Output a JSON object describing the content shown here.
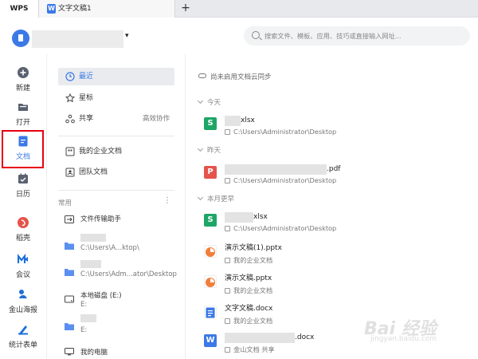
{
  "tabbar": {
    "app_tab": "WPS",
    "doc_tab": "文字文稿1",
    "add_tab": "+"
  },
  "header": {
    "caret": "▾",
    "search_placeholder": "搜索文件、模板、应用、技巧或直接输入网址..."
  },
  "rail": [
    {
      "name": "new",
      "label": "新建",
      "icon": "plus-circle-icon"
    },
    {
      "name": "open",
      "label": "打开",
      "icon": "folder-icon"
    },
    {
      "name": "docs",
      "label": "文档",
      "icon": "document-icon",
      "selected": true
    },
    {
      "name": "calendar",
      "label": "日历",
      "icon": "calendar-icon"
    },
    {
      "name": "daoke",
      "label": "稻壳",
      "icon": "daoke-icon"
    },
    {
      "name": "meeting",
      "label": "会议",
      "icon": "meeting-icon"
    },
    {
      "name": "poster",
      "label": "金山海报",
      "icon": "poster-icon"
    },
    {
      "name": "form",
      "label": "统计表单",
      "icon": "form-icon"
    }
  ],
  "nav": {
    "recent": "最近",
    "starred": "星标",
    "shared": "共享",
    "shared_extra": "高效协作",
    "my_enterprise": "我的企业文档",
    "team": "团队文档"
  },
  "common": {
    "title": "常用",
    "more": "⋮",
    "items": [
      {
        "label": "文件传输助手",
        "path": ""
      },
      {
        "label": "",
        "path": "C:\\Users\\A...ktop\\"
      },
      {
        "label": "",
        "path": "C:\\Users\\Adm...ator\\Desktop"
      },
      {
        "label": "本地磁盘 (E:)",
        "path": "E:"
      },
      {
        "label": "",
        "path": "E:"
      },
      {
        "label": "我的电脑",
        "path": ""
      }
    ]
  },
  "files": {
    "sync_text": "尚未启用文档云同步",
    "groups": [
      "今天",
      "昨天",
      "本月更早"
    ],
    "items": [
      {
        "name": "xlsx",
        "location": "C:\\Users\\Administrator\\Desktop",
        "type": "sheet",
        "color": "#1da668"
      },
      {
        "name": ".pdf",
        "location": "C:\\Users\\Administrator\\Desktop",
        "type": "pdf",
        "color": "#e5534b"
      },
      {
        "name": "xlsx",
        "location": "C:\\Users\\Administrator\\Desktop",
        "type": "sheet",
        "color": "#1da668"
      },
      {
        "name": "演示文稿(1).pptx",
        "location": "我的企业文档",
        "type": "ppt",
        "color": "#f07f3c"
      },
      {
        "name": "演示文稿.pptx",
        "location": "我的企业文档",
        "type": "ppt",
        "color": "#f07f3c"
      },
      {
        "name": "文字文稿.docx",
        "location": "我的企业文档",
        "type": "doc",
        "color": "#3b79e7"
      },
      {
        "name": ".docx",
        "location": "金山文档 共享",
        "type": "doc",
        "color": "#3b79e7"
      }
    ]
  },
  "watermark": {
    "main": "Bai 经验",
    "sub": "jingyan.baidu.com"
  },
  "colors": {
    "accent": "#3b79e7",
    "selection_border": "#e60012",
    "wps_red": "#e5534b"
  }
}
